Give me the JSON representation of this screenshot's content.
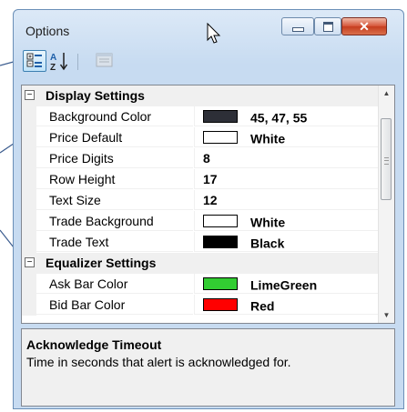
{
  "window": {
    "title": "Options",
    "controls": {
      "minimize": "",
      "maximize": "",
      "close": "✕"
    }
  },
  "toolbar": {
    "categorized_icon": "categorized-icon",
    "alphabetical_icon": "sort-az-icon",
    "property_pages_icon": "property-pages-icon"
  },
  "grid": {
    "rows": [
      {
        "kind": "category",
        "label": "Display Settings",
        "toggle": "−"
      },
      {
        "kind": "prop",
        "name": "Background Color",
        "value": "45, 47, 55",
        "swatch": "#2d2f37"
      },
      {
        "kind": "prop",
        "name": "Price Default",
        "value": "White",
        "swatch": "#ffffff"
      },
      {
        "kind": "prop",
        "name": "Price Digits",
        "value": "8"
      },
      {
        "kind": "prop",
        "name": "Row Height",
        "value": "17"
      },
      {
        "kind": "prop",
        "name": "Text Size",
        "value": "12"
      },
      {
        "kind": "prop",
        "name": "Trade Background",
        "value": "White",
        "swatch": "#ffffff"
      },
      {
        "kind": "prop",
        "name": "Trade Text",
        "value": "Black",
        "swatch": "#000000"
      },
      {
        "kind": "category",
        "label": "Equalizer Settings",
        "toggle": "−"
      },
      {
        "kind": "prop",
        "name": "Ask Bar Color",
        "value": "LimeGreen",
        "swatch": "#32cd32"
      },
      {
        "kind": "prop",
        "name": "Bid Bar Color",
        "value": "Red",
        "swatch": "#ff0000"
      }
    ]
  },
  "help": {
    "title": "Acknowledge Timeout",
    "description": "Time in seconds that alert is acknowledged for."
  },
  "colors": {
    "callout_line": "#3c5d8f",
    "grid_line": "#f0f0f0",
    "selected_tool": "#bfe3f9"
  }
}
